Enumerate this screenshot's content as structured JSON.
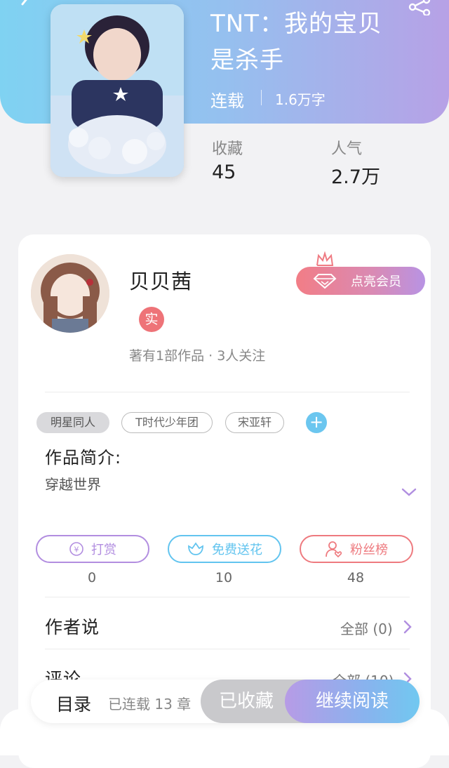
{
  "book": {
    "title_line1": "TNT：我的宝贝",
    "title_line2": "是杀手",
    "status": "连载",
    "word_count": "1.6万字",
    "stats": {
      "favorites_label": "收藏",
      "favorites_value": "45",
      "popularity_label": "人气",
      "popularity_value": "2.7万"
    }
  },
  "author": {
    "name": "贝贝茜",
    "badge": "实",
    "meta": "著有1部作品 · 3人关注",
    "vip_button": "点亮会员"
  },
  "tags": [
    "明星同人",
    "T时代少年团",
    "宋亚轩"
  ],
  "intro": {
    "title": "作品简介:",
    "text": "穿越世界"
  },
  "actions": [
    {
      "label": "打赏",
      "count": "0",
      "color": "#b28ee0"
    },
    {
      "label": "免费送花",
      "count": "10",
      "color": "#62c4ef"
    },
    {
      "label": "粉丝榜",
      "count": "48",
      "color": "#ee7a7f"
    }
  ],
  "sections": {
    "author_says": {
      "title": "作者说",
      "link": "全部 (0)"
    },
    "comments": {
      "title": "评论",
      "link": "全部 (10)"
    }
  },
  "bottom_bar": {
    "toc": "目录",
    "serialized": "已连载 13 章",
    "collected": "已收藏",
    "continue_reading": "继续阅读"
  },
  "colors": {
    "header_gradient_start": "#7fd2f2",
    "header_gradient_end": "#b7a1e6",
    "accent_purple": "#b28ee0",
    "accent_blue": "#62c4ef",
    "accent_red": "#ee7a7f"
  }
}
